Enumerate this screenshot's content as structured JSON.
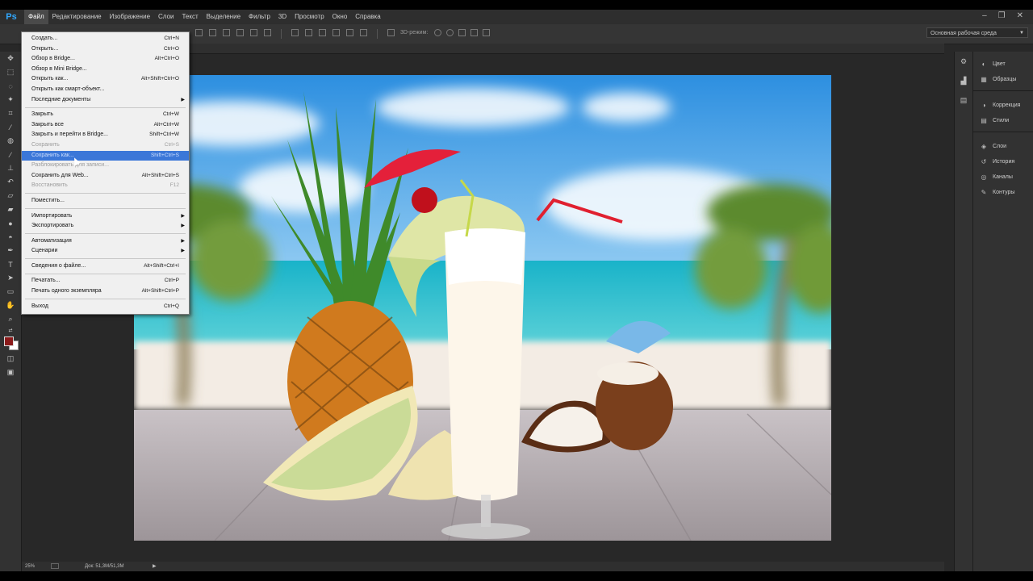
{
  "app": {
    "logo": "Ps"
  },
  "menubar": {
    "items": [
      "Файл",
      "Редактирование",
      "Изображение",
      "Слои",
      "Текст",
      "Выделение",
      "Фильтр",
      "3D",
      "Просмотр",
      "Окно",
      "Справка"
    ],
    "window_controls": [
      "‒",
      "❐",
      "✕"
    ]
  },
  "options": {
    "label_3d": "3D-режим:",
    "workspace": "Основная рабочая среда"
  },
  "file_menu": {
    "groups": [
      [
        {
          "label": "Создать...",
          "shortcut": "Ctrl+N"
        },
        {
          "label": "Открыть...",
          "shortcut": "Ctrl+O"
        },
        {
          "label": "Обзор в Bridge...",
          "shortcut": "Alt+Ctrl+O"
        },
        {
          "label": "Обзор в Mini Bridge...",
          "shortcut": ""
        },
        {
          "label": "Открыть как...",
          "shortcut": "Alt+Shift+Ctrl+O"
        },
        {
          "label": "Открыть как смарт-объект...",
          "shortcut": ""
        },
        {
          "label": "Последние документы",
          "shortcut": "",
          "submenu": true
        }
      ],
      [
        {
          "label": "Закрыть",
          "shortcut": "Ctrl+W"
        },
        {
          "label": "Закрыть все",
          "shortcut": "Alt+Ctrl+W"
        },
        {
          "label": "Закрыть и перейти в Bridge...",
          "shortcut": "Shift+Ctrl+W"
        },
        {
          "label": "Сохранить",
          "shortcut": "Ctrl+S",
          "disabled": true
        },
        {
          "label": "Сохранить как...",
          "shortcut": "Shift+Ctrl+S",
          "highlighted": true
        },
        {
          "label": "Разблокировать для записи...",
          "shortcut": "",
          "disabled": true
        },
        {
          "label": "Сохранить для Web...",
          "shortcut": "Alt+Shift+Ctrl+S"
        },
        {
          "label": "Восстановить",
          "shortcut": "F12",
          "disabled": true
        }
      ],
      [
        {
          "label": "Поместить...",
          "shortcut": ""
        }
      ],
      [
        {
          "label": "Импортировать",
          "shortcut": "",
          "submenu": true
        },
        {
          "label": "Экспортировать",
          "shortcut": "",
          "submenu": true
        }
      ],
      [
        {
          "label": "Автоматизация",
          "shortcut": "",
          "submenu": true
        },
        {
          "label": "Сценарии",
          "shortcut": "",
          "submenu": true
        }
      ],
      [
        {
          "label": "Сведения о файле...",
          "shortcut": "Alt+Shift+Ctrl+I"
        }
      ],
      [
        {
          "label": "Печатать...",
          "shortcut": "Ctrl+P"
        },
        {
          "label": "Печать одного экземпляра",
          "shortcut": "Alt+Shift+Ctrl+P"
        }
      ],
      [
        {
          "label": "Выход",
          "shortcut": "Ctrl+Q"
        }
      ]
    ]
  },
  "panels": {
    "groups": [
      [
        {
          "label": "Цвет",
          "icon": "◐"
        },
        {
          "label": "Образцы",
          "icon": "▦"
        }
      ],
      [
        {
          "label": "Коррекция",
          "icon": "◑"
        },
        {
          "label": "Стили",
          "icon": "▤"
        }
      ],
      [
        {
          "label": "Слои",
          "icon": "◈"
        },
        {
          "label": "История",
          "icon": "↺"
        },
        {
          "label": "Каналы",
          "icon": "◎"
        },
        {
          "label": "Контуры",
          "icon": "✎"
        }
      ]
    ]
  },
  "status": {
    "zoom": "25%",
    "doc": "Док: 51,3M/51,3M",
    "arrow": "▶"
  },
  "colors": {
    "foreground": "#8b1a1a",
    "background": "#ffffff",
    "highlight": "#3b77d8"
  }
}
